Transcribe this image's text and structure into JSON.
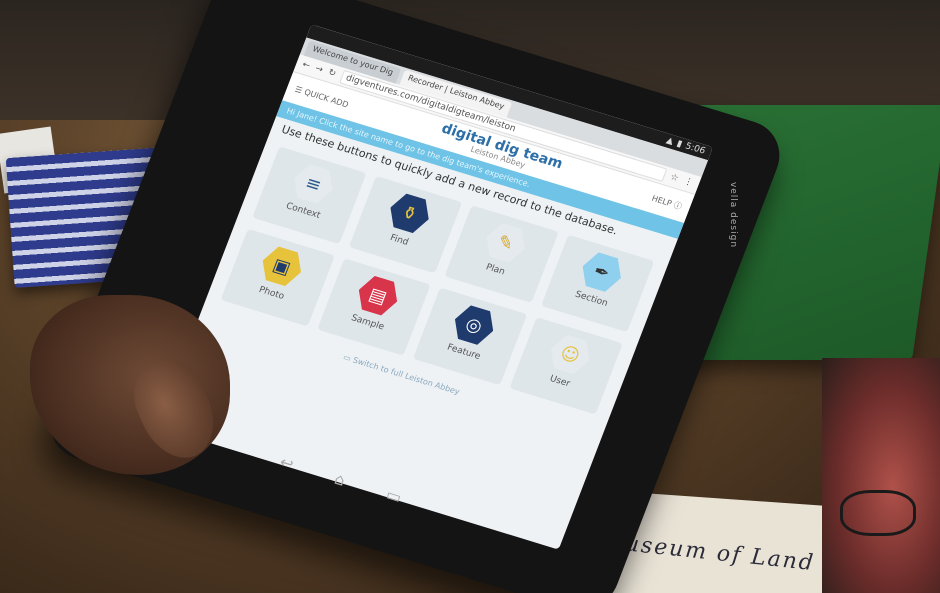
{
  "browser": {
    "status_time": "5:06",
    "tabs": [
      "Welcome to your Dig",
      "Recorder | Leiston Abbey"
    ],
    "url": "digventures.com/digitaldigteam/leiston"
  },
  "app": {
    "menu_label": "QUICK ADD",
    "logo_text": "digital dig team",
    "site_name": "Leiston Abbey",
    "banner_text": "Hi Jane! Click the site name to go to the dig team's experience.",
    "help_label": "HELP",
    "intro_text": "Use these buttons to quickly add a new record to the database.",
    "footer_link": "Switch to full Leiston Abbey"
  },
  "tiles": [
    {
      "label": "Context",
      "color": "#e4eaee",
      "icon": "lines-icon"
    },
    {
      "label": "Find",
      "color": "#1f3b6e",
      "icon": "pot-icon"
    },
    {
      "label": "Plan",
      "color": "#e4eaee",
      "icon": "ruler-pencil-icon"
    },
    {
      "label": "Section",
      "color": "#8fd0ee",
      "icon": "pen-nib-icon"
    },
    {
      "label": "Photo",
      "color": "#e7c23b",
      "icon": "photo-icon"
    },
    {
      "label": "Sample",
      "color": "#d8344a",
      "icon": "jar-icon"
    },
    {
      "label": "Feature",
      "color": "#1f3b6e",
      "icon": "compass-icon"
    },
    {
      "label": "User",
      "color": "#e4eaee",
      "icon": "user-icon"
    }
  ],
  "case_label": "vella design",
  "handwriting": "Museum of Land"
}
